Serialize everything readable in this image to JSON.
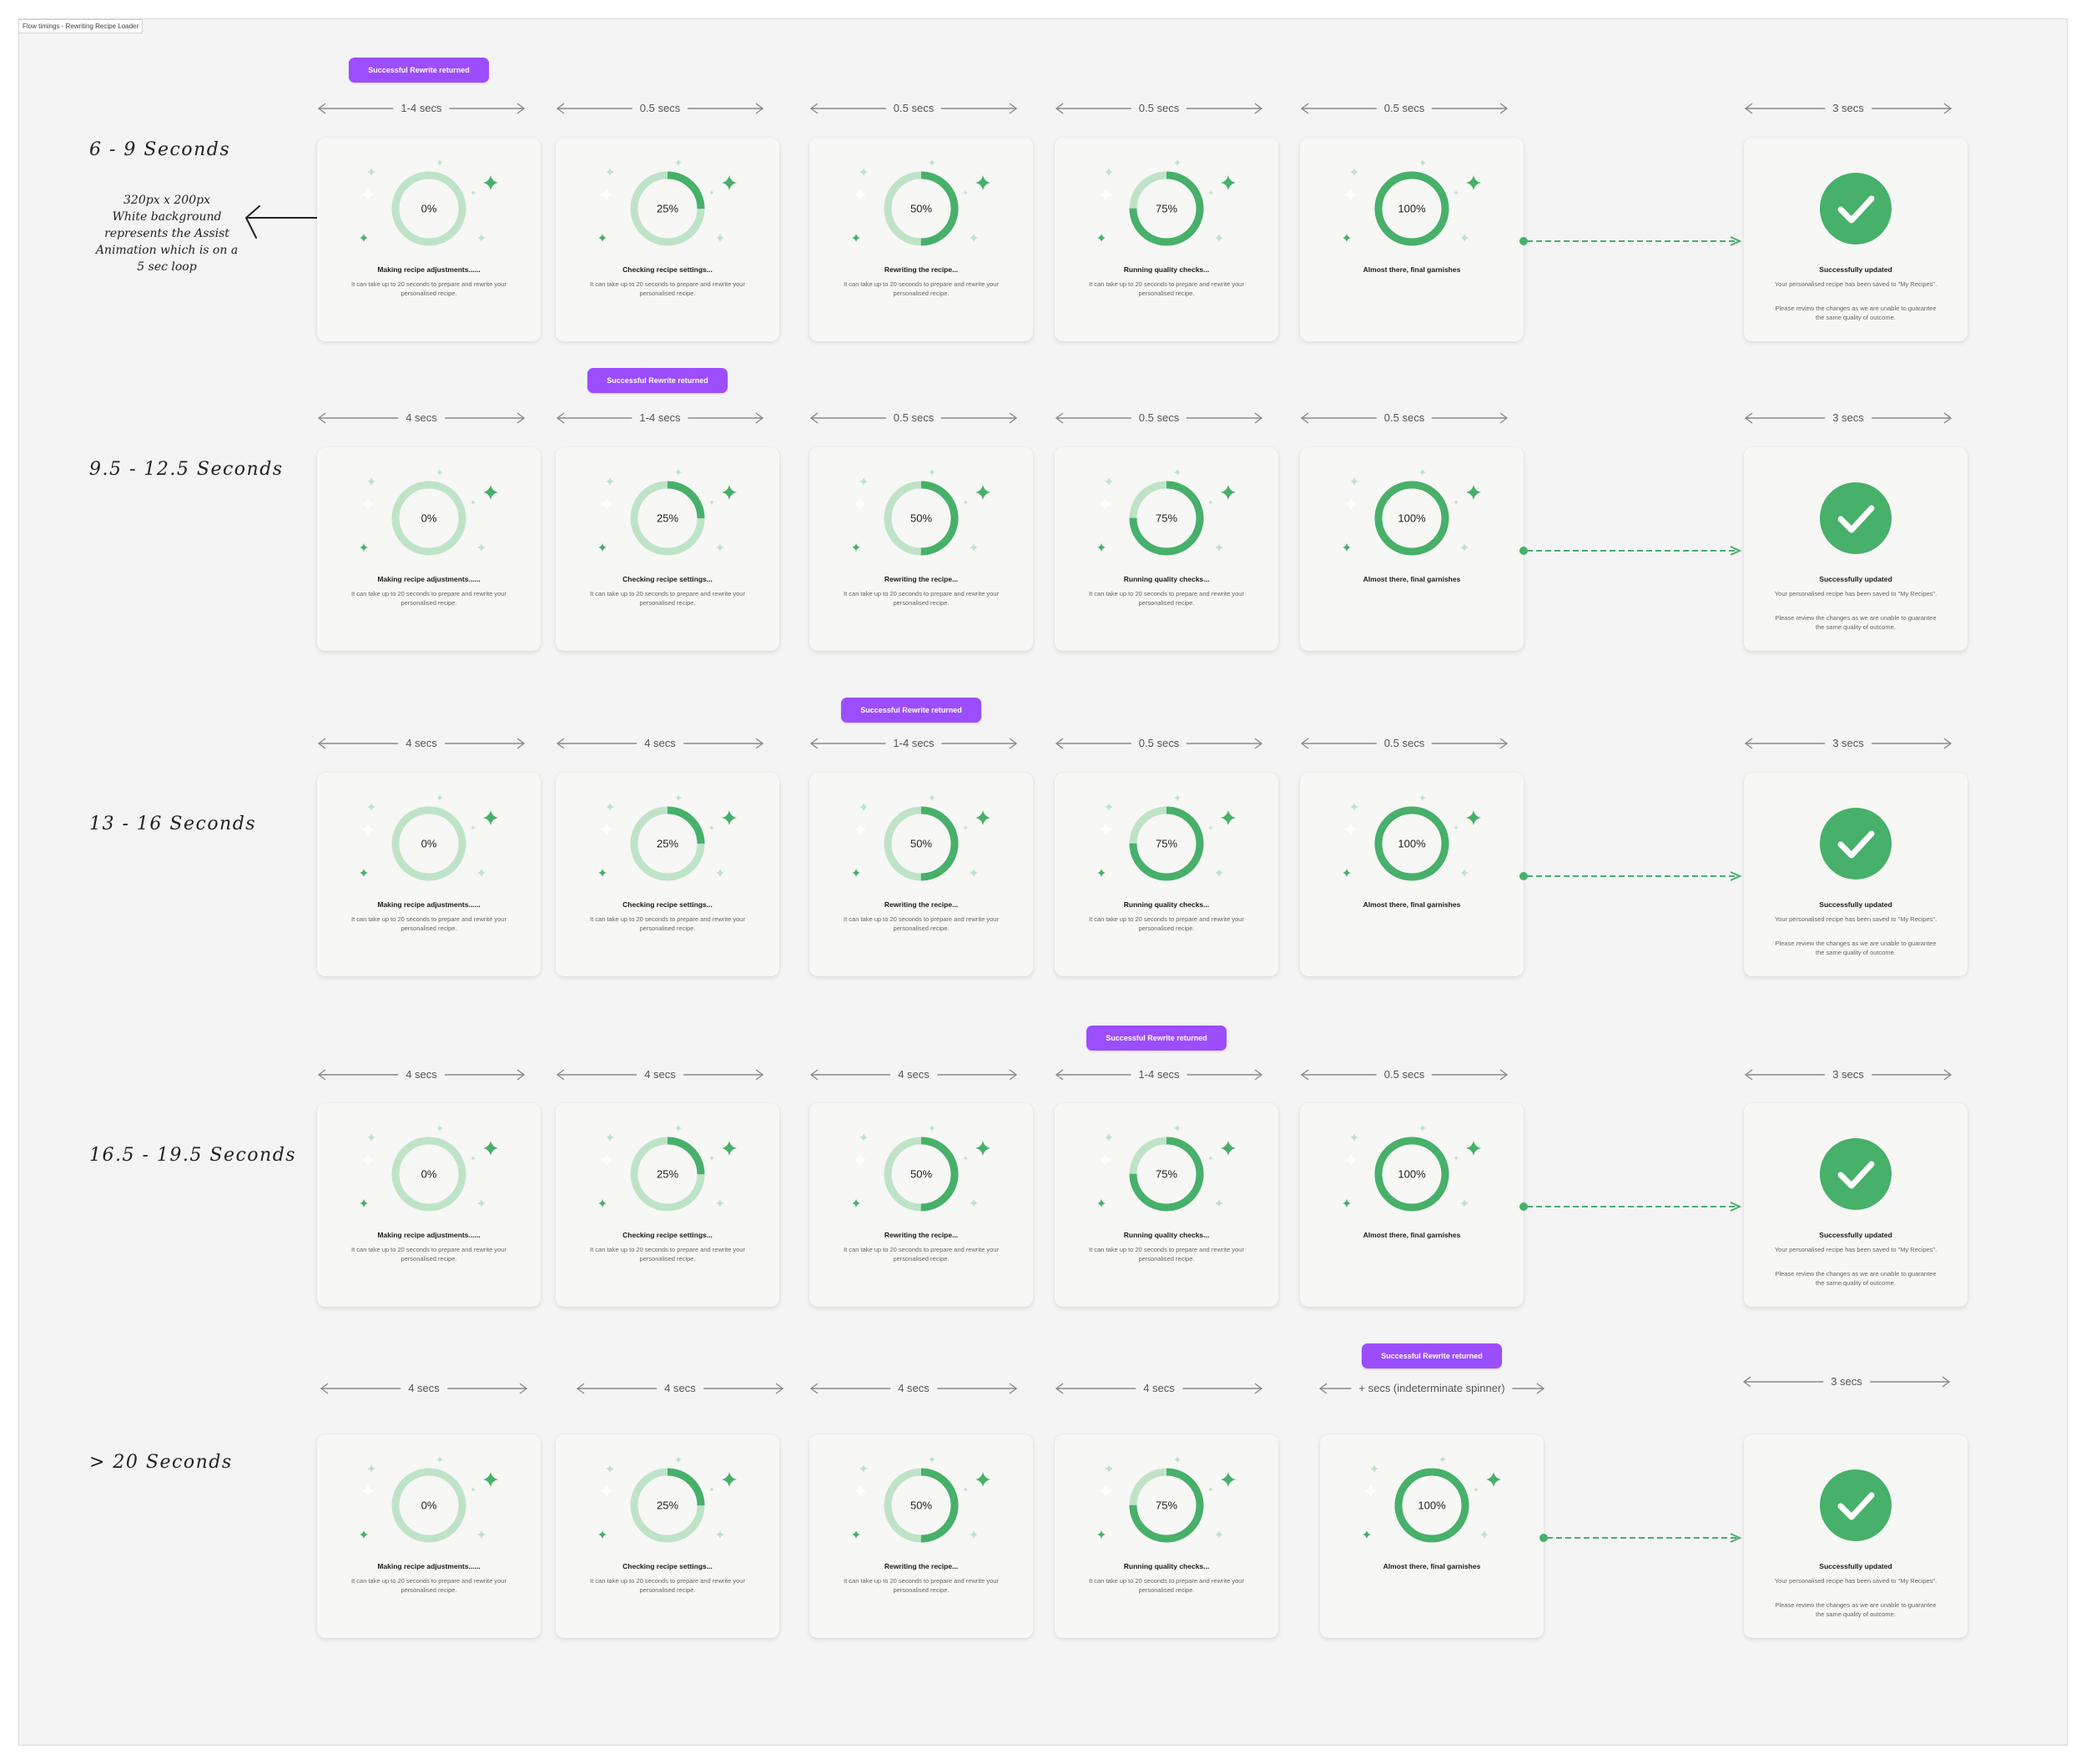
{
  "frame_label": "Flow timings - Rewriting Recipe Loader",
  "note": {
    "text": "320px x 200px\nWhite background\nrepresents the Assist\nAnimation which is on a\n5 sec loop"
  },
  "badge_label": "Successful Rewrite returned",
  "colors": {
    "accent_green": "#47b06a",
    "ring_light": "#bfe3c8",
    "badge_purple": "#9b4dff",
    "card_bg": "#f7f7f5",
    "canvas_bg": "#f4f4f4"
  },
  "icons": {
    "sparkle": "sparkle-icon",
    "check": "checkmark-icon",
    "arrow": "double-arrow-icon"
  },
  "steps": [
    {
      "percent": 0,
      "percent_label": "0%",
      "title": "Making recipe adjustments......",
      "desc": "It can take up to 20 seconds to prepare and rewrite your personalised recipe."
    },
    {
      "percent": 25,
      "percent_label": "25%",
      "title": "Checking recipe settings...",
      "desc": "It can take up to 20 seconds to prepare and rewrite your personalised recipe."
    },
    {
      "percent": 50,
      "percent_label": "50%",
      "title": "Rewriting the recipe...",
      "desc": "It can take up to 20 seconds to prepare and rewrite your personalised recipe."
    },
    {
      "percent": 75,
      "percent_label": "75%",
      "title": "Running quality checks...",
      "desc": "It can take up to 20 seconds to prepare and rewrite your personalised recipe."
    },
    {
      "percent": 100,
      "percent_label": "100%",
      "title": "Almost there, final garnishes",
      "desc": ""
    }
  ],
  "success": {
    "title": "Successfully updated",
    "desc": "Your personalised recipe has been saved to \"My Recipes\".",
    "desc2": "Please review the changes as we are unable to guarantee the same quality of outcome."
  },
  "rows": [
    {
      "label": "6 - 9 Seconds",
      "badge_column": 0,
      "durations": [
        "1-4 secs",
        "0.5 secs",
        "0.5 secs",
        "0.5 secs",
        "0.5 secs",
        "3 secs"
      ]
    },
    {
      "label": "9.5 - 12.5 Seconds",
      "badge_column": 1,
      "durations": [
        "4 secs",
        "1-4 secs",
        "0.5 secs",
        "0.5 secs",
        "0.5 secs",
        "3 secs"
      ]
    },
    {
      "label": "13 - 16 Seconds",
      "badge_column": 2,
      "durations": [
        "4 secs",
        "4 secs",
        "1-4 secs",
        "0.5 secs",
        "0.5 secs",
        "3 secs"
      ]
    },
    {
      "label": "16.5 - 19.5 Seconds",
      "badge_column": 3,
      "durations": [
        "4 secs",
        "4 secs",
        "4 secs",
        "1-4 secs",
        "0.5 secs",
        "3 secs"
      ]
    },
    {
      "label": "> 20 Seconds",
      "badge_column": 4,
      "durations": [
        "4 secs",
        "4 secs",
        "4 secs",
        "4 secs",
        "+ secs (indeterminate spinner)",
        "3 secs"
      ]
    }
  ]
}
